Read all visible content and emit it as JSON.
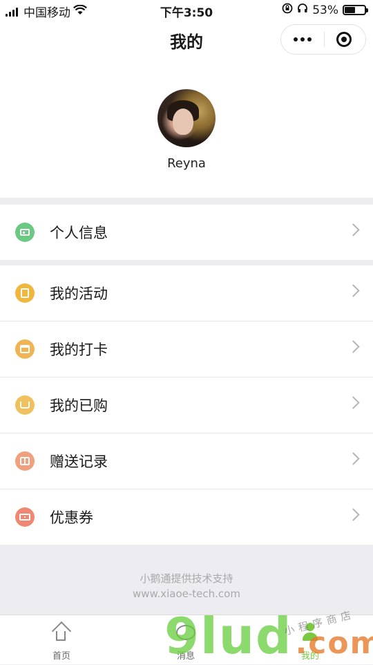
{
  "status_bar": {
    "carrier": "中国移动",
    "time": "下午3:50",
    "battery_percent": "53%",
    "battery_level": 0.53,
    "icons": [
      "signal-icon",
      "wifi-icon",
      "rotation-lock-icon",
      "headphones-icon",
      "battery-icon"
    ]
  },
  "nav": {
    "title": "我的",
    "capsule_icons": [
      "more-icon",
      "close-target-icon"
    ]
  },
  "profile": {
    "username": "Reyna"
  },
  "menu": {
    "info": [
      {
        "label": "个人信息",
        "icon": "id-card-icon",
        "color": "#6cc984"
      }
    ],
    "main": [
      {
        "label": "我的活动",
        "icon": "activity-icon",
        "color": "#f0b73e"
      },
      {
        "label": "我的打卡",
        "icon": "calendar-icon",
        "color": "#f0b455"
      },
      {
        "label": "我的已购",
        "icon": "cart-icon",
        "color": "#f1c05e"
      },
      {
        "label": "赠送记录",
        "icon": "gift-icon",
        "color": "#f0a07c"
      },
      {
        "label": "优惠券",
        "icon": "coupon-icon",
        "color": "#ef8873"
      }
    ]
  },
  "footer": {
    "line1": "小鹅通提供技术支持",
    "line2": "www.xiaoe-tech.com"
  },
  "tabs": [
    {
      "label": "首页",
      "icon": "home-icon",
      "active": false
    },
    {
      "label": "消息",
      "icon": "message-icon",
      "active": false
    },
    {
      "label": "我的",
      "icon": "profile-icon",
      "active": true
    }
  ],
  "watermark": {
    "brand": "9lud",
    "suffix": ".com",
    "tagline": "小程序商店"
  },
  "colors": {
    "accent_green": "#7ac943",
    "background": "#ececf1"
  }
}
